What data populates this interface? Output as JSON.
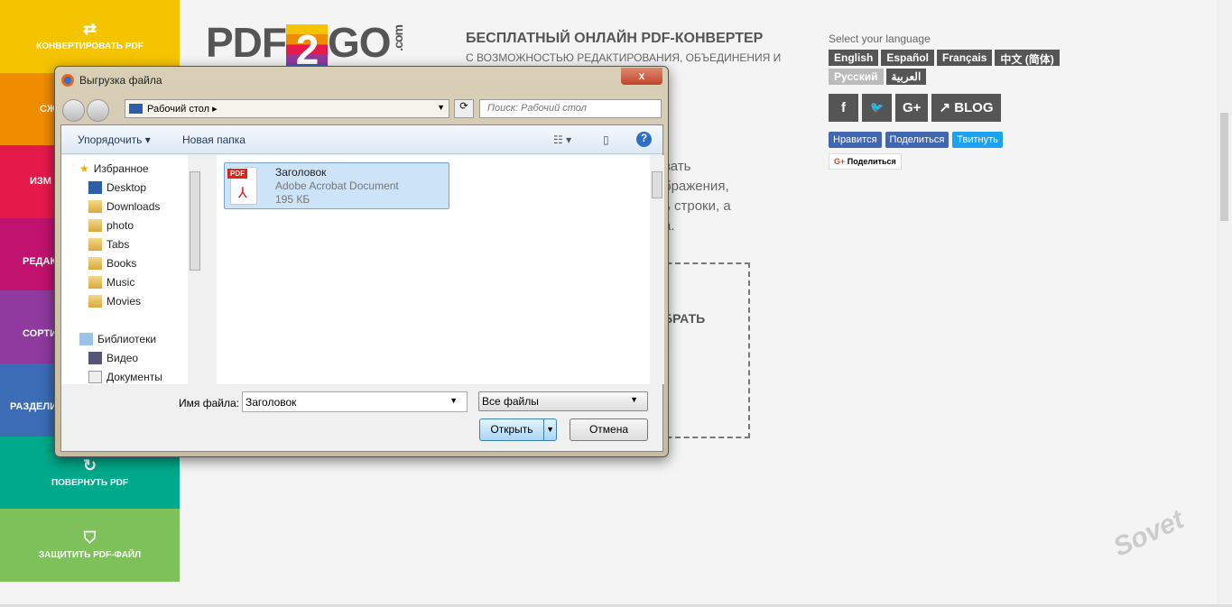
{
  "sidebar": {
    "items": [
      {
        "label": "КОНВЕРТИРОВАТЬ PDF",
        "icon": "arrows-swap-icon",
        "color": "#f5c400"
      },
      {
        "label": "СЖ",
        "icon": "compress-icon",
        "color": "#f08c00"
      },
      {
        "label": "ИЗМ",
        "icon": "edit-icon",
        "color": "#e6194b"
      },
      {
        "label": "РЕДАК",
        "icon": "edit-icon",
        "color": "#c0126e"
      },
      {
        "label": "СОРТИ",
        "icon": "sort-icon",
        "color": "#8e3a9e"
      },
      {
        "label": "РАЗДЕЛИ",
        "icon": "split-icon",
        "color": "#3b6cb5"
      },
      {
        "label": "ПОВЕРНУТЬ PDF",
        "icon": "rotate-icon",
        "color": "#00a98a"
      },
      {
        "label": "ЗАЩИТИТЬ PDF-ФАЙЛ",
        "icon": "shield-icon",
        "color": "#7ec05a"
      }
    ]
  },
  "logo": {
    "pdf": "PDF",
    "two": "2",
    "go": "GO",
    "com": ".com"
  },
  "header": {
    "title": "БЕСПЛАТНЫЙ ОНЛАЙН PDF-КОНВЕРТЕР",
    "subtitle": "С ВОЗМОЖНОСТЬЮ РЕДАКТИРОВАНИЯ, ОБЪЕДИНЕНИЯ И"
  },
  "main": {
    "lines": [
      "вать",
      "бражения,",
      "ь строки, а",
      "а."
    ],
    "choose": "БРАТЬ"
  },
  "language": {
    "label": "Select your language",
    "options": [
      "English",
      "Español",
      "Français",
      "中文 (简体)",
      "Русский",
      "العربية"
    ],
    "active": "Русский"
  },
  "social": {
    "facebook": "f",
    "twitter": "🐦",
    "gplus": "G+",
    "blog": "BLOG"
  },
  "share": {
    "fb_like": "Нравится",
    "fb_share": "Поделиться",
    "tweet": "Твитнуть",
    "gplus_share": "Поделиться"
  },
  "dialog": {
    "title": "Выгрузка файла",
    "location": "Рабочий стол",
    "search_placeholder": "Поиск: Рабочий стол",
    "organize": "Упорядочить",
    "new_folder": "Новая папка",
    "tree": [
      "Избранное",
      "Desktop",
      "Downloads",
      "photo",
      "Tabs",
      "Books",
      "Music",
      "Movies",
      "Библиотеки",
      "Видео",
      "Документы"
    ],
    "file": {
      "name": "Заголовок",
      "type": "Adobe Acrobat Document",
      "size": "195 КБ"
    },
    "filename_label": "Имя файла:",
    "filename_value": "Заголовок",
    "filetype": "Все файлы",
    "open": "Открыть",
    "cancel": "Отмена"
  },
  "watermark": "club Sovet"
}
